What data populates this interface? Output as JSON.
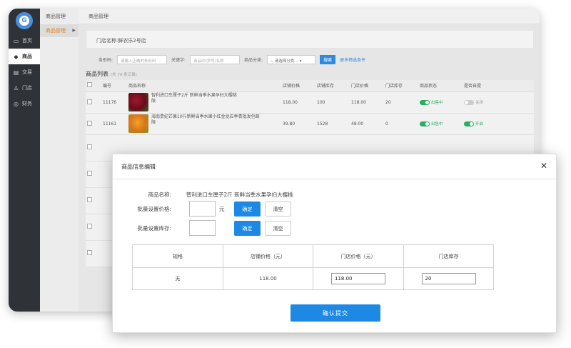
{
  "sidebar": {
    "logo_letter": "G",
    "items": [
      {
        "label": "首页",
        "icon": "monitor-icon"
      },
      {
        "label": "商品",
        "icon": "tag-icon",
        "active": true
      },
      {
        "label": "交易",
        "icon": "document-icon"
      },
      {
        "label": "门店",
        "icon": "user-icon"
      },
      {
        "label": "财务",
        "icon": "coin-icon"
      }
    ]
  },
  "subnav": {
    "title": "商品管理",
    "item": "商品管理"
  },
  "breadcrumb": "商品管理",
  "store": {
    "label": "门店名称:鲜农乐2号店"
  },
  "filters": {
    "barcode_label": "条形码:",
    "barcode_placeholder": "请输入正确的条形码",
    "keyword_label": "关键字:",
    "keyword_placeholder": "商品ID/货号/名称",
    "category_label": "商品分类:",
    "category_value": "-- 请选择分类 --",
    "search_label": "搜索",
    "more_label": "更多筛选条件"
  },
  "list": {
    "title": "商品列表",
    "count": "(共 70 条记录)",
    "headers": [
      "编号",
      "商品名称",
      "店铺价格",
      "店铺库存",
      "门店价格",
      "门店库存",
      "商品状态",
      "是否自提"
    ],
    "rows": [
      {
        "id": "11176",
        "name": "智利进口车厘子2斤 新鲜当季水果孕妇大樱桃",
        "tag": "限",
        "shop_price": "118.00",
        "shop_stock": "100",
        "store_price": "118.00",
        "store_stock": "20",
        "status": "出售中",
        "pickup": "关闭"
      },
      {
        "id": "11161",
        "name": "海南贵妃芒果10斤新鲜当季水果小红金龙应季青批发包邮",
        "tag": "限",
        "shop_price": "39.80",
        "shop_stock": "1528",
        "store_price": "48.00",
        "store_stock": "0",
        "status": "出售中",
        "pickup": "开启"
      }
    ]
  },
  "modal": {
    "title": "商品信息编辑",
    "product_label": "商品名称:",
    "product_name": "智利进口车厘子2斤 新鲜当季水果孕妇大樱桃",
    "batch_price_label": "批量设置价格:",
    "yuan": "元",
    "confirm_label": "确定",
    "clear_label": "清空",
    "batch_stock_label": "批量设置库存:",
    "table_headers": [
      "规格",
      "店铺价格（元）",
      "门店价格（元）",
      "门店库存"
    ],
    "table_row": {
      "spec": "无",
      "shop_price": "118.00",
      "store_price": "118.00",
      "store_stock": "20"
    },
    "submit_label": "确认提交"
  },
  "colors": {
    "primary": "#1e88e5",
    "sidebar": "#2f3237",
    "active_toggle": "#27ae60"
  }
}
